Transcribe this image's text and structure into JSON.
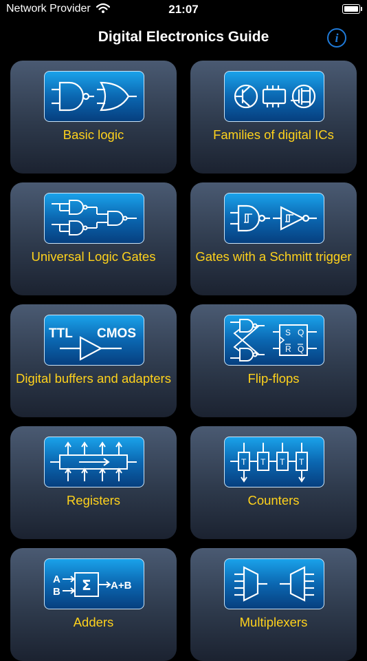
{
  "status": {
    "carrier": "Network Provider",
    "time": "21:07"
  },
  "header": {
    "title": "Digital Electronics Guide"
  },
  "cards": [
    {
      "label": "Basic logic",
      "icon": "logic-gates-icon",
      "tile_text": []
    },
    {
      "label": "Families of digital ICs",
      "icon": "ic-components-icon",
      "tile_text": []
    },
    {
      "label": "Universal Logic Gates",
      "icon": "nand-network-icon",
      "tile_text": []
    },
    {
      "label": "Gates with a Schmitt trigger",
      "icon": "schmitt-gates-icon",
      "tile_text": []
    },
    {
      "label": "Digital buffers and adapters",
      "icon": "level-buffer-icon",
      "tile_text": [
        "TTL",
        "CMOS"
      ]
    },
    {
      "label": "Flip-flops",
      "icon": "flip-flop-icon",
      "tile_text": [
        "S",
        "Q",
        "R",
        "Q"
      ]
    },
    {
      "label": "Registers",
      "icon": "register-icon",
      "tile_text": []
    },
    {
      "label": "Counters",
      "icon": "counter-icon",
      "tile_text": [
        "T",
        "T",
        "T",
        "T"
      ]
    },
    {
      "label": "Adders",
      "icon": "adder-icon",
      "tile_text": [
        "A",
        "B",
        "Σ",
        "A+B"
      ]
    },
    {
      "label": "Multiplexers",
      "icon": "multiplexer-icon",
      "tile_text": []
    }
  ]
}
